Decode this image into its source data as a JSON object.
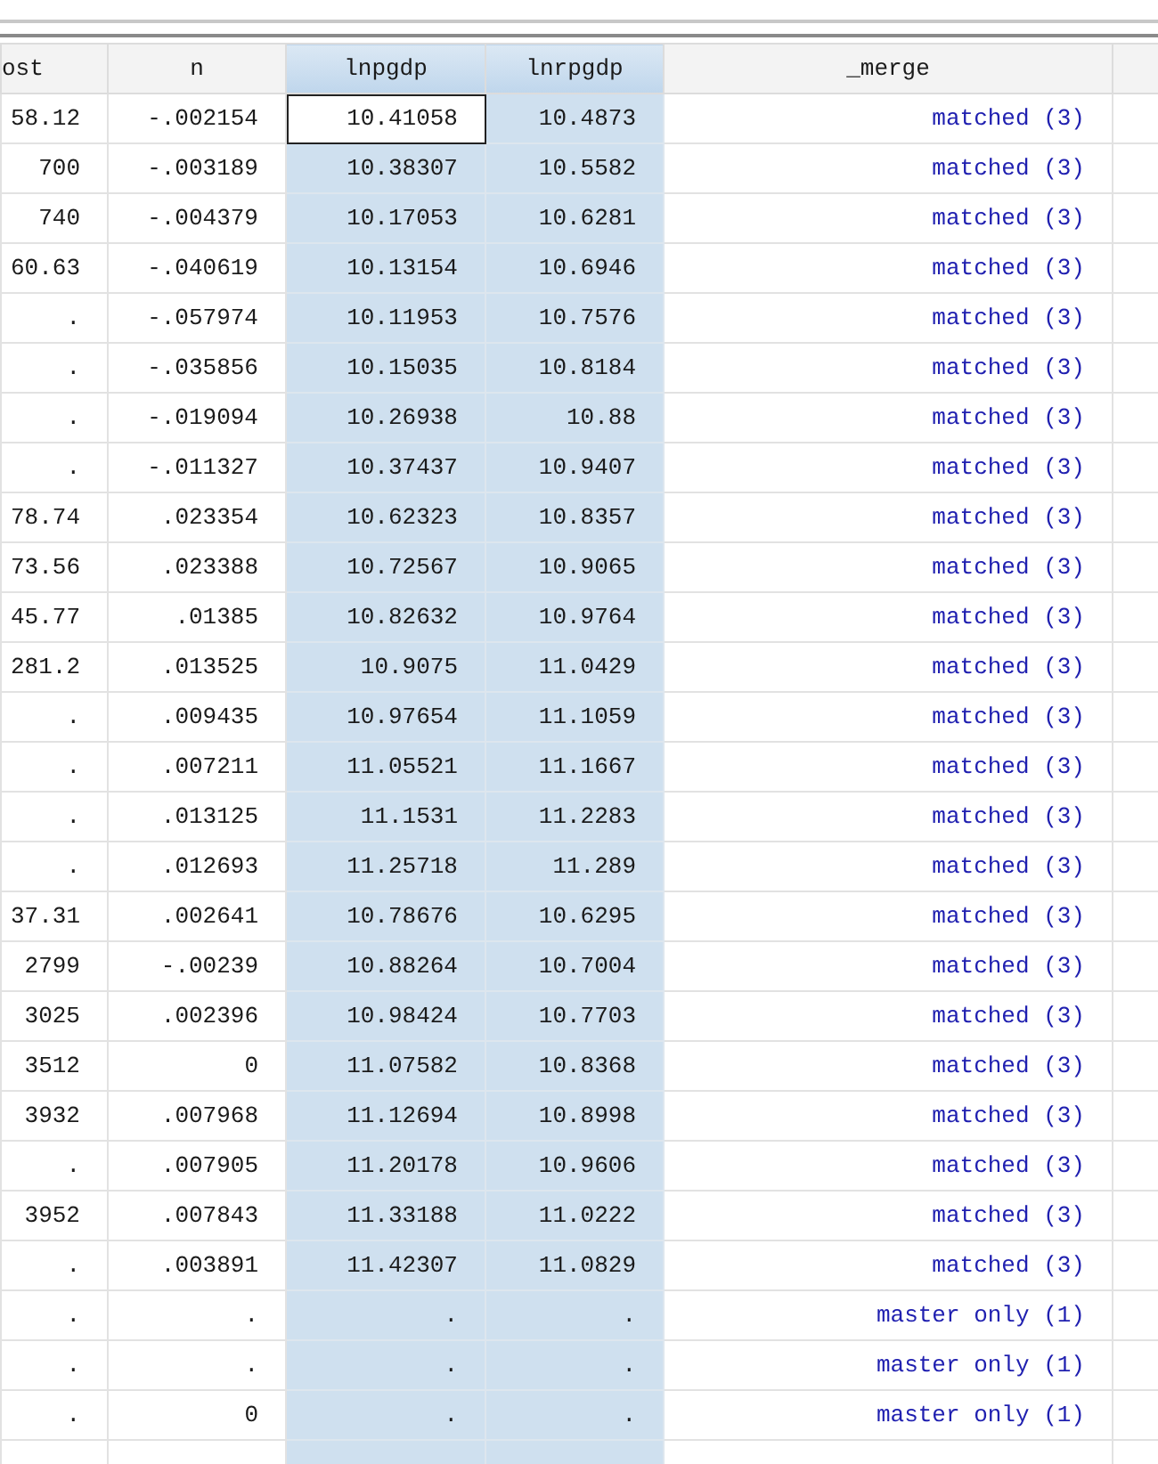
{
  "columns": [
    {
      "label": "ost",
      "selected": false,
      "current": false
    },
    {
      "label": "n",
      "selected": false,
      "current": false
    },
    {
      "label": "lnpgdp",
      "selected": true,
      "current": true
    },
    {
      "label": "lnrpgdp",
      "selected": true,
      "current": false
    },
    {
      "label": "_merge",
      "selected": false,
      "current": false
    }
  ],
  "rows": [
    {
      "cells": [
        "58.12",
        "-.002154",
        "10.41058",
        "10.4873",
        "matched (3)"
      ],
      "current": true
    },
    {
      "cells": [
        "700",
        "-.003189",
        "10.38307",
        "10.5582",
        "matched (3)"
      ],
      "current": false
    },
    {
      "cells": [
        "740",
        "-.004379",
        "10.17053",
        "10.6281",
        "matched (3)"
      ],
      "current": false
    },
    {
      "cells": [
        "60.63",
        "-.040619",
        "10.13154",
        "10.6946",
        "matched (3)"
      ],
      "current": false
    },
    {
      "cells": [
        ".",
        "-.057974",
        "10.11953",
        "10.7576",
        "matched (3)"
      ],
      "current": false
    },
    {
      "cells": [
        ".",
        "-.035856",
        "10.15035",
        "10.8184",
        "matched (3)"
      ],
      "current": false
    },
    {
      "cells": [
        ".",
        "-.019094",
        "10.26938",
        "10.88",
        "matched (3)"
      ],
      "current": false
    },
    {
      "cells": [
        ".",
        "-.011327",
        "10.37437",
        "10.9407",
        "matched (3)"
      ],
      "current": false
    },
    {
      "cells": [
        "78.74",
        ".023354",
        "10.62323",
        "10.8357",
        "matched (3)"
      ],
      "current": false
    },
    {
      "cells": [
        "73.56",
        ".023388",
        "10.72567",
        "10.9065",
        "matched (3)"
      ],
      "current": false
    },
    {
      "cells": [
        "45.77",
        ".01385",
        "10.82632",
        "10.9764",
        "matched (3)"
      ],
      "current": false
    },
    {
      "cells": [
        "281.2",
        ".013525",
        "10.9075",
        "11.0429",
        "matched (3)"
      ],
      "current": false
    },
    {
      "cells": [
        ".",
        ".009435",
        "10.97654",
        "11.1059",
        "matched (3)"
      ],
      "current": false
    },
    {
      "cells": [
        ".",
        ".007211",
        "11.05521",
        "11.1667",
        "matched (3)"
      ],
      "current": false
    },
    {
      "cells": [
        ".",
        ".013125",
        "11.1531",
        "11.2283",
        "matched (3)"
      ],
      "current": false
    },
    {
      "cells": [
        ".",
        ".012693",
        "11.25718",
        "11.289",
        "matched (3)"
      ],
      "current": false
    },
    {
      "cells": [
        "37.31",
        ".002641",
        "10.78676",
        "10.6295",
        "matched (3)"
      ],
      "current": false
    },
    {
      "cells": [
        "2799",
        "-.00239",
        "10.88264",
        "10.7004",
        "matched (3)"
      ],
      "current": false
    },
    {
      "cells": [
        "3025",
        ".002396",
        "10.98424",
        "10.7703",
        "matched (3)"
      ],
      "current": false
    },
    {
      "cells": [
        "3512",
        "0",
        "11.07582",
        "10.8368",
        "matched (3)"
      ],
      "current": false
    },
    {
      "cells": [
        "3932",
        ".007968",
        "11.12694",
        "10.8998",
        "matched (3)"
      ],
      "current": false
    },
    {
      "cells": [
        ".",
        ".007905",
        "11.20178",
        "10.9606",
        "matched (3)"
      ],
      "current": false
    },
    {
      "cells": [
        "3952",
        ".007843",
        "11.33188",
        "11.0222",
        "matched (3)"
      ],
      "current": false
    },
    {
      "cells": [
        ".",
        ".003891",
        "11.42307",
        "11.0829",
        "matched (3)"
      ],
      "current": false
    },
    {
      "cells": [
        ".",
        ".",
        ".",
        ".",
        "master only (1)"
      ],
      "current": false
    },
    {
      "cells": [
        ".",
        ".",
        ".",
        ".",
        "master only (1)"
      ],
      "current": false
    },
    {
      "cells": [
        ".",
        "0",
        ".",
        ".",
        "master only (1)"
      ],
      "current": false
    }
  ]
}
